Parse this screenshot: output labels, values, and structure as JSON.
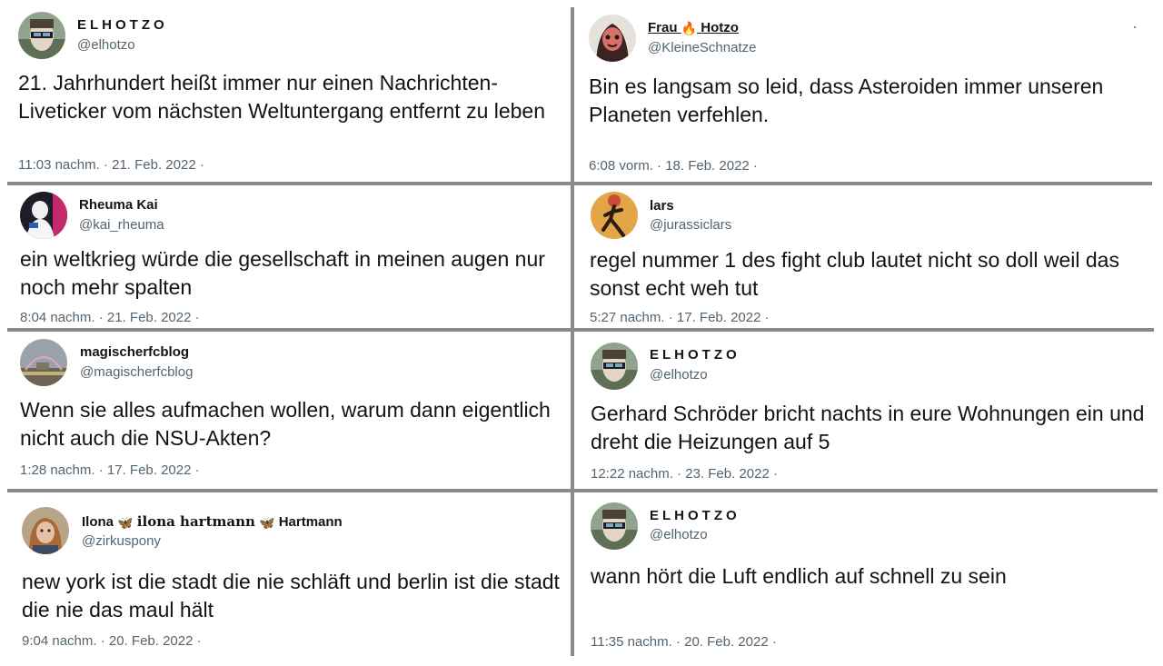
{
  "tweets": [
    {
      "name": "ELHOTZO",
      "handle": "@elhotzo",
      "text": "21. Jahrhundert heißt immer nur einen Nachrichten-Liveticker vom nächsten Weltuntergang entfernt zu leben",
      "meta": "11:03 nachm. · 21. Feb. 2022 ·"
    },
    {
      "name_part1": "Frau",
      "name_emoji": "🔥",
      "name_part2": "Hotzo",
      "handle": "@KleineSchnatze",
      "text": "Bin es langsam so leid, dass Asteroiden immer unseren Planeten verfehlen.",
      "meta": "6:08 vorm. · 18. Feb. 2022 ·"
    },
    {
      "name": "Rheuma Kai",
      "handle": "@kai_rheuma",
      "text": "ein weltkrieg würde die gesellschaft in meinen augen nur noch mehr spalten",
      "meta": "8:04 nachm. · 21. Feb. 2022 ·"
    },
    {
      "name": "lars",
      "handle": "@jurassiclars",
      "text": "regel nummer 1 des fight club lautet nicht so doll weil das sonst echt weh tut",
      "meta": "5:27 nachm. · 17. Feb. 2022 ·"
    },
    {
      "name": "magischerfcblog",
      "handle": "@magischerfcblog",
      "text": "Wenn sie alles aufmachen wollen, warum dann eigentlich nicht auch die NSU-Akten?",
      "meta": "1:28 nachm. · 17. Feb. 2022 ·"
    },
    {
      "name": "ELHOTZO",
      "handle": "@elhotzo",
      "text": "Gerhard Schröder bricht nachts in eure Wohnungen ein und dreht die Heizungen auf 5",
      "meta": "12:22 nachm. · 23. Feb. 2022 ·"
    },
    {
      "name_part1": "Ilona",
      "name_emoji1": "🦋",
      "name_part2": "ilona hartmann",
      "name_emoji2": "🦋",
      "name_part3": "Hartmann",
      "handle": "@zirkuspony",
      "text": "new york ist die stadt die nie schläft und berlin ist die stadt die nie das maul hält",
      "meta": "9:04 nachm. · 20. Feb. 2022 ·"
    },
    {
      "name": "ELHOTZO",
      "handle": "@elhotzo",
      "text": "wann hört die Luft endlich auf schnell zu sein",
      "meta": "11:35 nachm. · 20. Feb. 2022 ·"
    }
  ],
  "colors": {
    "text": "#0f1419",
    "secondary": "#536471",
    "divider": "#8a8a8a",
    "background": "#ffffff"
  },
  "icons": {
    "flame": "fire-emoji-icon",
    "butterfly": "butterfly-emoji-icon"
  }
}
